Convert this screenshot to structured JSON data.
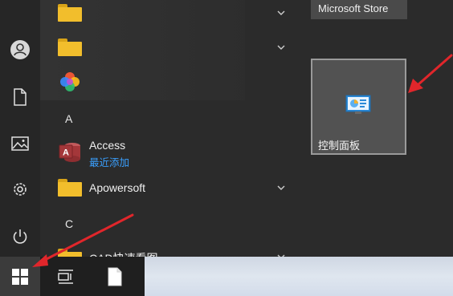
{
  "app_list": {
    "section_a": "A",
    "section_c": "C",
    "access_name": "Access",
    "access_sub": "最近添加",
    "apowersoft_name": "Apowersoft",
    "cad_name": "CAD快速看图"
  },
  "tiles": {
    "store_label": "Microsoft Store",
    "control_panel_label": "控制面板"
  },
  "colors": {
    "accent_blue": "#3aa0ff",
    "annotation_red": "#e0262b",
    "access_red": "#a4373a",
    "folder_yellow": "#f2be2c"
  },
  "icons": {
    "rail": [
      "user-icon",
      "document-icon",
      "pictures-icon",
      "settings-icon",
      "power-icon"
    ],
    "taskbar": [
      "windows-logo-icon",
      "task-view-icon",
      "file-icon"
    ]
  }
}
